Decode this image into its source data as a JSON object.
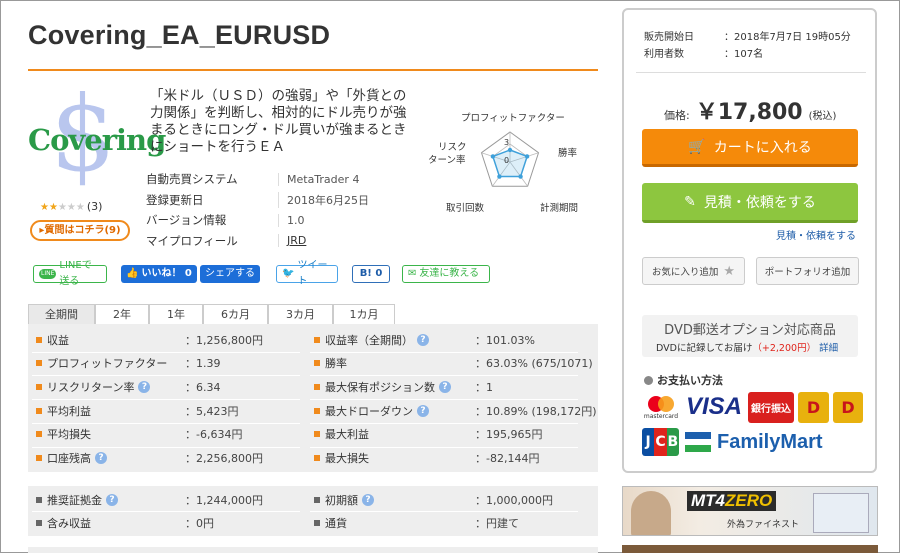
{
  "product": {
    "title": "Covering_EA_EURUSD",
    "logo_word": "Covering",
    "logo_symbol": "$",
    "description": "「米ドル（ＵＳＤ）の強弱」や「外貨との力関係」を判断し、相対的にドル売りが強まるときにロング・ドル買いが強まるときにショートを行うＥＡ",
    "rating": 2,
    "rating_max": 5,
    "review_count": "(3)",
    "qa_button": "質問はコチラ(9)"
  },
  "meta": [
    {
      "label": "自動売買システム",
      "value": "MetaTrader 4"
    },
    {
      "label": "登録更新日",
      "value": "2018年6月25日"
    },
    {
      "label": "バージョン情報",
      "value": "1.0"
    },
    {
      "label": "マイプロフィール",
      "value": "JRD"
    }
  ],
  "radar": {
    "labels": {
      "pf": "プロフィットファクター",
      "win": "勝率",
      "period": "計測期間",
      "trades": "取引回数",
      "risk_1": "リスク",
      "risk_2": "ターン率"
    },
    "scale_label": "3",
    "center_label": "0",
    "values": {
      "pf": 2,
      "win": 3,
      "period": 3,
      "trades": 3,
      "risk": 3
    },
    "max": 5
  },
  "share": {
    "line": "LINEで送る",
    "line_icon": "LINE",
    "fb_like": "いいね！ 0",
    "fb_share": "シェアする",
    "tweet": "ツイート",
    "hatena": "B! 0",
    "friend": "友達に教える"
  },
  "tabs": [
    "全期間",
    "2年",
    "1年",
    "6カ月",
    "3カ月",
    "1カ月"
  ],
  "active_tab": 0,
  "stats_left": [
    {
      "label": "収益",
      "value": "：1,256,800円",
      "help": false
    },
    {
      "label": "プロフィットファクター",
      "value": "：1.39",
      "help": false
    },
    {
      "label": "リスクリターン率",
      "value": "：6.34",
      "help": true
    },
    {
      "label": "平均利益",
      "value": "：5,423円",
      "help": false
    },
    {
      "label": "平均損失",
      "value": "：-6,634円",
      "help": false
    },
    {
      "label": "口座残高",
      "value": "：2,256,800円",
      "help": true
    }
  ],
  "stats_right": [
    {
      "label": "収益率（全期間）",
      "value": "：101.03%",
      "help": true
    },
    {
      "label": "勝率",
      "value": "：63.03% (675/1071)",
      "help": false
    },
    {
      "label": "最大保有ポジション数",
      "value": "：1",
      "help": true
    },
    {
      "label": "最大ドローダウン",
      "value": "：10.89% (198,172円)",
      "help": true
    },
    {
      "label": "最大利益",
      "value": "：195,965円",
      "help": false
    },
    {
      "label": "最大損失",
      "value": "：-82,144円",
      "help": false
    }
  ],
  "stats2_left": [
    {
      "label": "推奨証拠金",
      "value": "：1,244,000円",
      "help": true
    },
    {
      "label": "含み収益",
      "value": "：0円",
      "help": false
    }
  ],
  "stats2_right": [
    {
      "label": "初期額",
      "value": "：1,000,000円",
      "help": true
    },
    {
      "label": "通貨",
      "value": "：円建て",
      "help": false
    }
  ],
  "panel": {
    "sale_start_label": "販売開始日",
    "sale_start_value": "：2018年7月7日 19時05分",
    "users_label": "利用者数",
    "users_value": "：107名",
    "price_label": "価格:",
    "price": "￥17,800",
    "tax": "(税込)",
    "cart": "カートに入れる",
    "quote": "見積・依頼をする",
    "quote_link": "見積・依頼をする",
    "favorite": "お気に入り追加",
    "portfolio": "ポートフォリオ追加",
    "dvd_title": "DVD郵送オプション対応商品",
    "dvd_text": "DVDに記録してお届け",
    "dvd_price": "（+2,200円）",
    "dvd_link": "詳細",
    "payment_title": "お支払い方法",
    "mastercard": "mastercard",
    "visa": "VISA",
    "bank": "銀行振込",
    "jcb": "JCB",
    "familymart": "FamilyMart",
    "daily_label": "Daily"
  },
  "banner": {
    "mt4": "MT4",
    "zero": "ZERO",
    "sub": "外為ファイネスト"
  },
  "colors": {
    "accent": "#f08a1c",
    "cart": "#f58a0a",
    "quote": "#8dc63f",
    "link": "#1d5ca8"
  }
}
